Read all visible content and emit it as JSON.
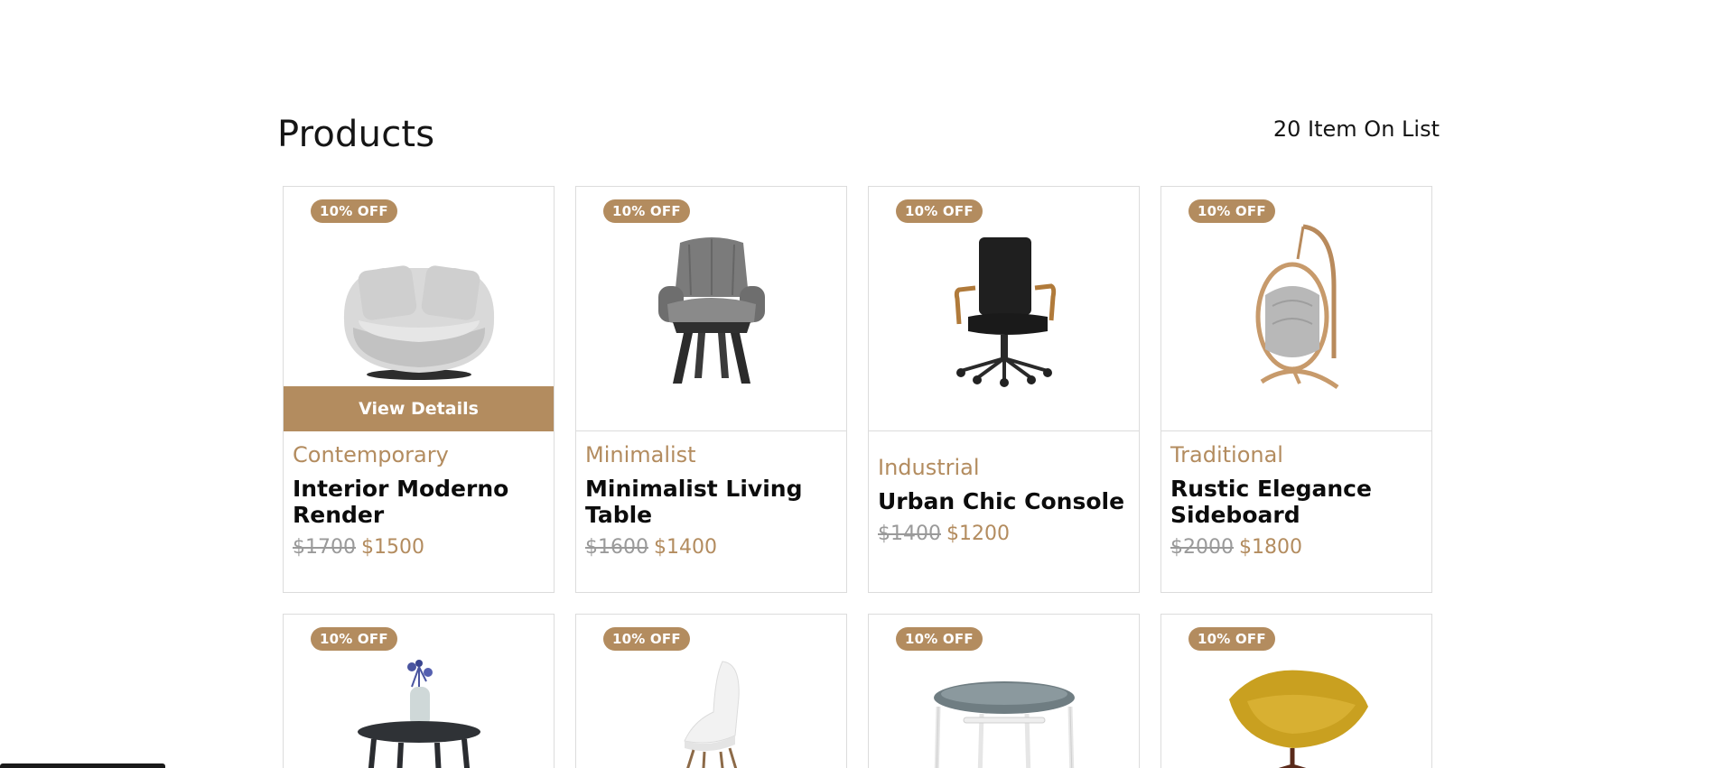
{
  "header": {
    "title": "Products",
    "item_count": "20 Item On List"
  },
  "colors": {
    "accent": "#b38c5f",
    "border": "#dcdcdc",
    "text": "#111111"
  },
  "products": [
    {
      "badge": "10% OFF",
      "category": "Contemporary",
      "name": "Interior Moderno Render",
      "old_price": "$1700",
      "price": "$1500",
      "action": "View Details",
      "image_icon": "round-armchair-icon"
    },
    {
      "badge": "10% OFF",
      "category": "Minimalist",
      "name": "Minimalist Living Table",
      "old_price": "$1600",
      "price": "$1400",
      "image_icon": "grey-lounge-chair-icon"
    },
    {
      "badge": "10% OFF",
      "category": "Industrial",
      "name": "Urban Chic Console",
      "old_price": "$1400",
      "price": "$1200",
      "image_icon": "office-chair-icon"
    },
    {
      "badge": "10% OFF",
      "category": "Traditional",
      "name": "Rustic Elegance Sideboard",
      "old_price": "$2000",
      "price": "$1800",
      "image_icon": "hanging-egg-chair-icon"
    },
    {
      "badge": "10% OFF",
      "image_icon": "side-table-with-vase-icon"
    },
    {
      "badge": "10% OFF",
      "image_icon": "white-shell-chair-icon"
    },
    {
      "badge": "10% OFF",
      "image_icon": "cushioned-stool-icon"
    },
    {
      "badge": "10% OFF",
      "image_icon": "yellow-cone-chair-icon"
    }
  ]
}
